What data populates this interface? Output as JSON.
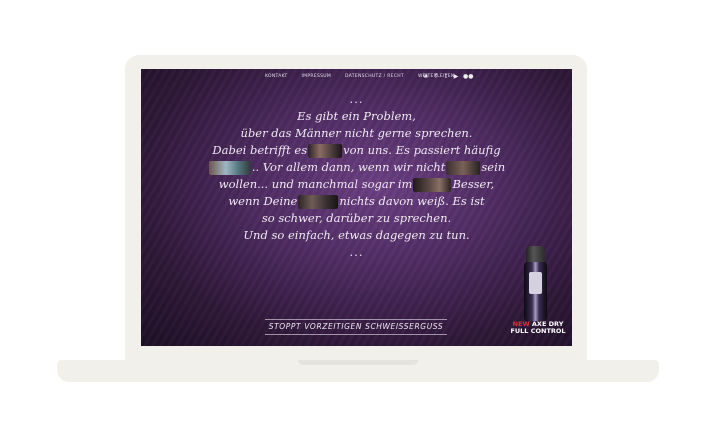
{
  "nav": {
    "items": [
      "Kontakt",
      "Impressum",
      "Datenschutz / Recht",
      "Weiterleiten"
    ],
    "social_icons": [
      "flower-icon",
      "facebook-icon",
      "twitter-icon",
      "youtube-icon",
      "flickr-icon"
    ],
    "social_glyphs": [
      "❀",
      "f",
      "t",
      "▶",
      "●●"
    ]
  },
  "poem": {
    "dots_top": "...",
    "line1": "Es gibt ein Problem,",
    "line2": "über das Männer nicht gerne sprechen.",
    "line3a": "Dabei betrifft es",
    "line3b": "von uns. Es passiert häufig",
    "line4a": ".. Vor allem dann, wenn wir nicht",
    "line4b": "sein",
    "line5a": "wollen... und manchmal sogar im",
    "line5b": "Besser,",
    "line6a": "wenn Deine",
    "line6b": "nichts davon weiß. Es ist",
    "line7": "so schwer, darüber zu sprechen.",
    "line8": "Und so einfach, etwas dagegen zu tun.",
    "dots_bottom": "..."
  },
  "slogan": "Stoppt vorzeitigen Schweisserguss",
  "product": {
    "new": "NEW",
    "brand": "AXE DRY",
    "line2": "FULL CONTROL"
  },
  "colors": {
    "background": "#4d2a60",
    "accent": "#e0332f",
    "text": "#f0ebf2"
  }
}
